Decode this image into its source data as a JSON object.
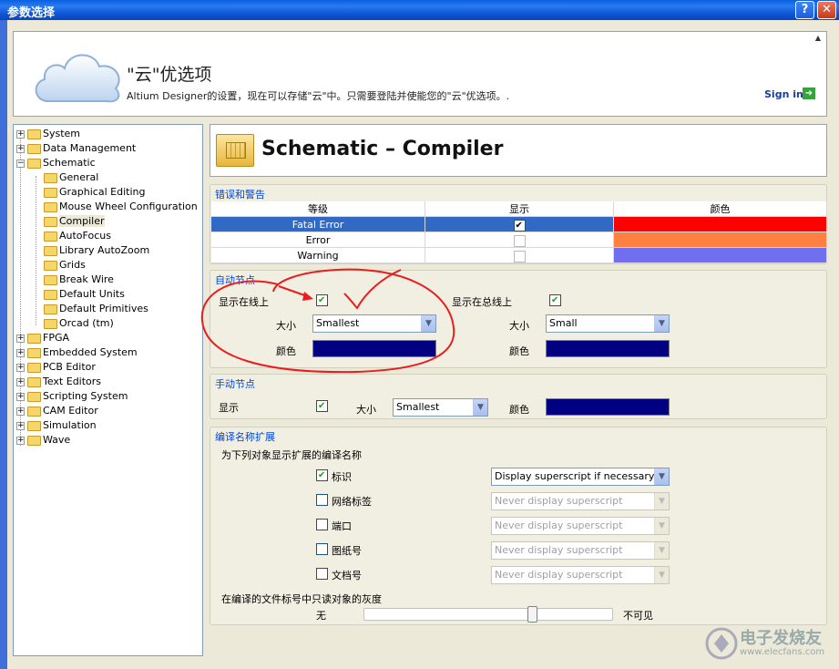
{
  "window": {
    "title": "参数选择",
    "help_label": "?",
    "close_label": "✕"
  },
  "banner": {
    "title": "\"云\"优选项",
    "subtitle": "Altium Designer的设置，现在可以存储\"云\"中。只需要登陆并使能您的\"云\"优选项。.",
    "signin": "Sign in"
  },
  "tree": [
    {
      "label": "System",
      "level": 0,
      "expanded": false
    },
    {
      "label": "Data Management",
      "level": 0,
      "expanded": false
    },
    {
      "label": "Schematic",
      "level": 0,
      "expanded": true
    },
    {
      "label": "General",
      "level": 1
    },
    {
      "label": "Graphical Editing",
      "level": 1
    },
    {
      "label": "Mouse Wheel Configuration",
      "level": 1
    },
    {
      "label": "Compiler",
      "level": 1,
      "selected": true
    },
    {
      "label": "AutoFocus",
      "level": 1
    },
    {
      "label": "Library AutoZoom",
      "level": 1
    },
    {
      "label": "Grids",
      "level": 1
    },
    {
      "label": "Break Wire",
      "level": 1
    },
    {
      "label": "Default Units",
      "level": 1
    },
    {
      "label": "Default Primitives",
      "level": 1
    },
    {
      "label": "Orcad (tm)",
      "level": 1
    },
    {
      "label": "FPGA",
      "level": 0,
      "expanded": false
    },
    {
      "label": "Embedded System",
      "level": 0,
      "expanded": false
    },
    {
      "label": "PCB Editor",
      "level": 0,
      "expanded": false
    },
    {
      "label": "Text Editors",
      "level": 0,
      "expanded": false
    },
    {
      "label": "Scripting System",
      "level": 0,
      "expanded": false
    },
    {
      "label": "CAM Editor",
      "level": 0,
      "expanded": false
    },
    {
      "label": "Simulation",
      "level": 0,
      "expanded": false
    },
    {
      "label": "Wave",
      "level": 0,
      "expanded": false
    }
  ],
  "page": {
    "title": "Schematic – Compiler"
  },
  "errors": {
    "title": "错误和警告",
    "columns": [
      "等级",
      "显示",
      "颜色"
    ],
    "rows": [
      {
        "level": "Fatal Error",
        "show": true,
        "color": "#ff0000",
        "selected": true
      },
      {
        "level": "Error",
        "show": false,
        "color": "#ff8040"
      },
      {
        "level": "Warning",
        "show": false,
        "color": "#6f6ff0"
      }
    ]
  },
  "auto_junction": {
    "title": "自动节点",
    "wire_label": "显示在线上",
    "wire_checked": true,
    "bus_label": "显示在总线上",
    "bus_checked": true,
    "size_label": "大小",
    "color_label": "颜色",
    "wire_size": "Smallest",
    "bus_size": "Small",
    "wire_color": "#000080",
    "bus_color": "#000080"
  },
  "manual_junction": {
    "title": "手动节点",
    "show_label": "显示",
    "show_checked": true,
    "size_label": "大小",
    "size": "Smallest",
    "color_label": "颜色",
    "color": "#000080"
  },
  "compiled_names": {
    "title": "编译名称扩展",
    "subtitle": "为下列对象显示扩展的编译名称",
    "items": [
      {
        "label": "标识",
        "checked": true,
        "option": "Display superscript if necessary",
        "enabled": true
      },
      {
        "label": "网络标签",
        "checked": false,
        "option": "Never display superscript",
        "enabled": false
      },
      {
        "label": "端口",
        "checked": false,
        "option": "Never display superscript",
        "enabled": false
      },
      {
        "label": "图纸号",
        "checked": false,
        "option": "Never display superscript",
        "enabled": false
      },
      {
        "label": "文档号",
        "checked": false,
        "option": "Never display superscript",
        "enabled": false
      }
    ],
    "dim_label": "在编译的文件标号中只读对象的灰度",
    "dim_min": "无",
    "dim_max": "不可见",
    "dim_value": 0.68
  },
  "watermark": {
    "line1": "电子发烧友",
    "line2": "www.elecfans.com"
  }
}
